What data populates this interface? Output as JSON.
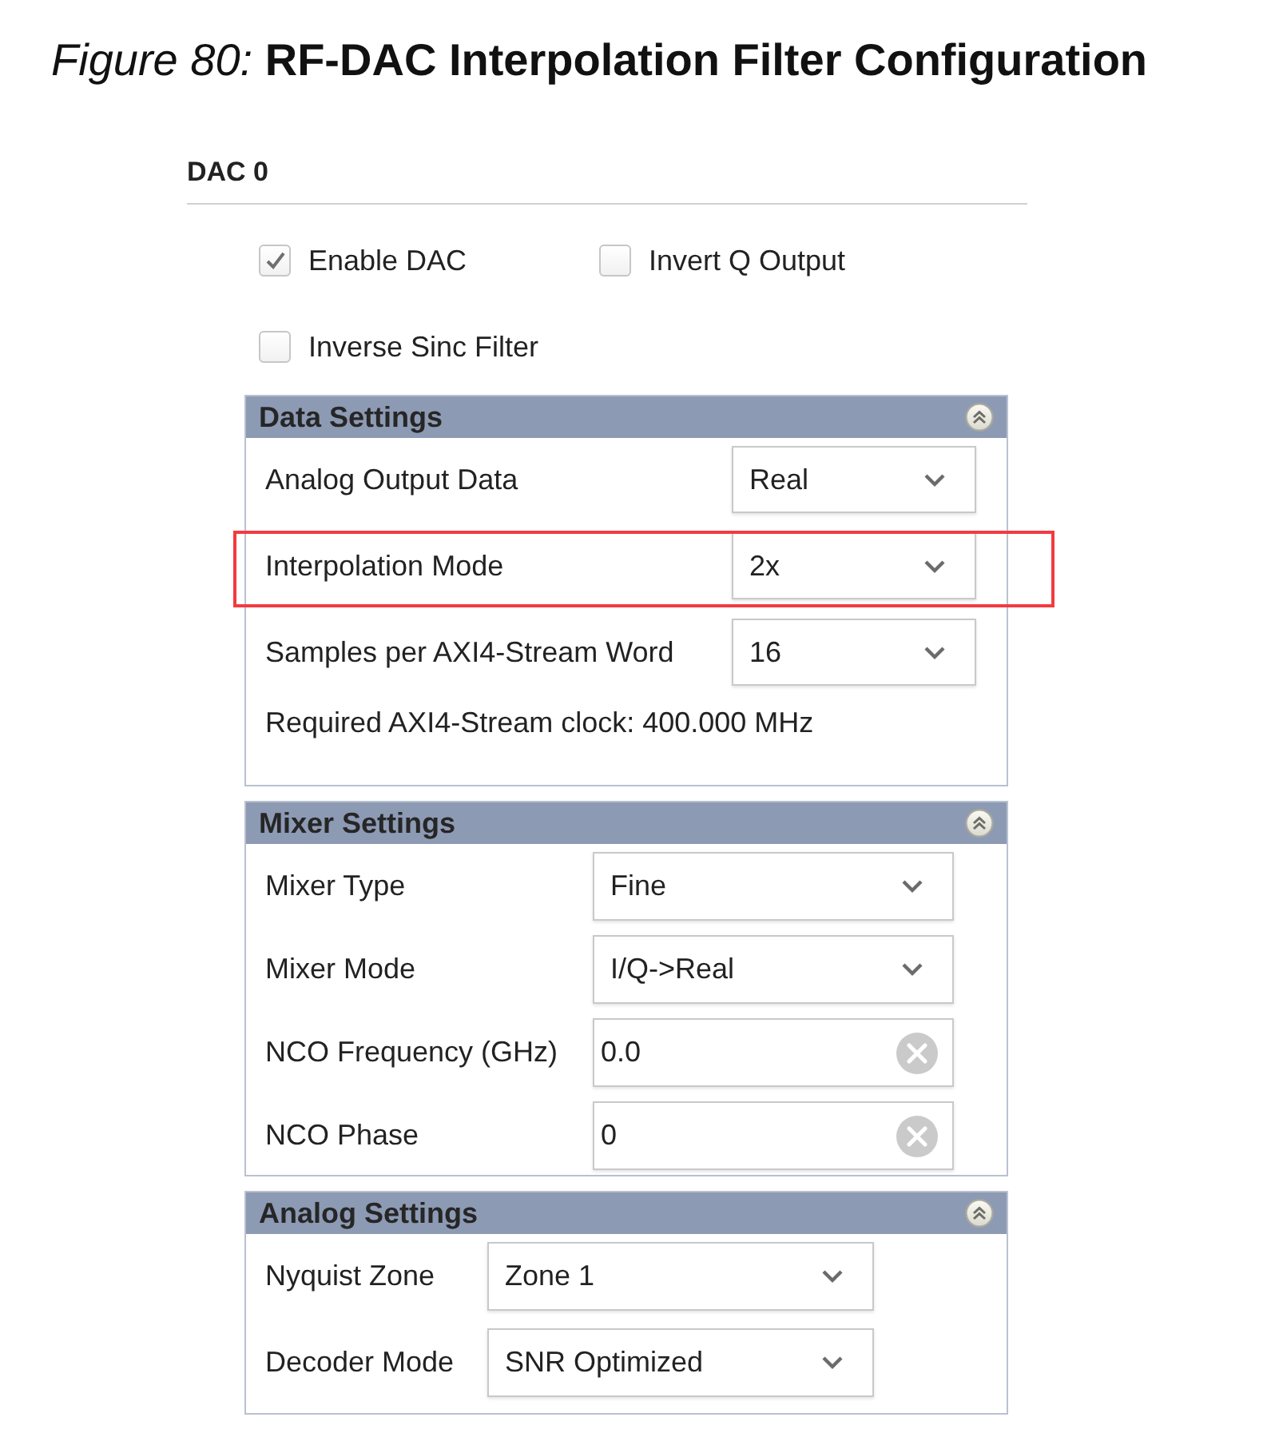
{
  "figure": {
    "caption": "*Figure 80:* **RF-DAC Interpolation Filter Configuration**"
  },
  "section": {
    "title": "DAC 0"
  },
  "checkboxes": [
    {
      "label": "Enable DAC",
      "checked": true
    },
    {
      "label": "Invert Q Output",
      "checked": false
    },
    {
      "label": "Inverse Sinc Filter",
      "checked": false
    }
  ],
  "panels": [
    {
      "title": "Data Settings",
      "expanded": true,
      "rows": [
        {
          "kind": "dropdown",
          "label": "Analog Output Data",
          "value": "Real",
          "highlighted": false
        },
        {
          "kind": "dropdown",
          "label": "Interpolation Mode",
          "value": "2x",
          "highlighted": true
        },
        {
          "kind": "dropdown",
          "label": "Samples per AXI4-Stream Word",
          "value": "16",
          "highlighted": false
        }
      ],
      "note": "Required AXI4-Stream clock: 400.000 MHz"
    },
    {
      "title": "Mixer Settings",
      "expanded": true,
      "rows": [
        {
          "kind": "dropdown",
          "label": "Mixer Type",
          "value": "Fine",
          "highlighted": false
        },
        {
          "kind": "dropdown",
          "label": "Mixer Mode",
          "value": "I/Q->Real",
          "highlighted": false
        },
        {
          "kind": "text",
          "label": "NCO Frequency (GHz)",
          "value": "0.0",
          "highlighted": false
        },
        {
          "kind": "text",
          "label": "NCO Phase",
          "value": "0",
          "highlighted": false
        }
      ]
    },
    {
      "title": "Analog Settings",
      "expanded": true,
      "rows": [
        {
          "kind": "dropdown",
          "label": "Nyquist Zone",
          "value": "Zone 1",
          "highlighted": false
        },
        {
          "kind": "dropdown",
          "label": "Decoder Mode",
          "value": "SNR Optimized",
          "highlighted": false
        }
      ]
    }
  ]
}
